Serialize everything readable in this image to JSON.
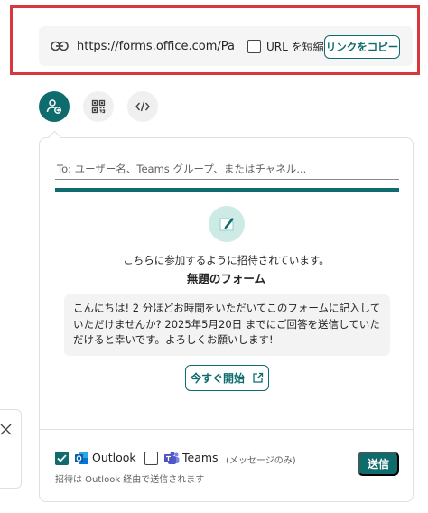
{
  "link_bar": {
    "url": "https://forms.office.com/Pages...",
    "shorten_label": "URL を短縮",
    "copy_label": "リンクをコピー"
  },
  "tabs": [
    {
      "name": "invite",
      "icon": "person-send-icon",
      "active": true
    },
    {
      "name": "qr",
      "icon": "qr-code-icon",
      "active": false
    },
    {
      "name": "embed",
      "icon": "code-icon",
      "active": false
    }
  ],
  "panel": {
    "to_placeholder": "To: ユーザー名、Teams グループ、またはチャネル...",
    "invite_text": "こちらに参加するように招待されています。",
    "form_title": "無題のフォーム",
    "message": "こんにちは! 2 分ほどお時間をいただいてこのフォームに記入していただけませんか? 2025年5月20日 までにご回答を送信していただけると幸いです。よろしくお願いします!",
    "start_label": "今すぐ開始"
  },
  "footer": {
    "outlook_label": "Outlook",
    "outlook_checked": true,
    "teams_label": "Teams",
    "teams_sub": "(メッセージのみ)",
    "teams_checked": false,
    "via_note": "招待は Outlook 経由で送信されます",
    "send_label": "送信"
  },
  "colors": {
    "accent": "#0f6c6c",
    "highlight": "#d9363e"
  }
}
